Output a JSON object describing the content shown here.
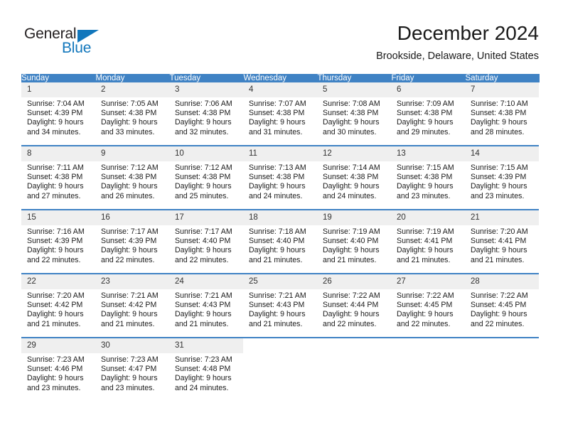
{
  "brand": {
    "name_part1": "General",
    "name_part2": "Blue",
    "accent_color": "#1277bc",
    "triangle_icon": "triangle-icon"
  },
  "header": {
    "title": "December 2024",
    "subtitle": "Brookside, Delaware, United States"
  },
  "calendar": {
    "header_bg": "#3f82c4",
    "daynum_bg": "#efefef",
    "weekdays": [
      "Sunday",
      "Monday",
      "Tuesday",
      "Wednesday",
      "Thursday",
      "Friday",
      "Saturday"
    ],
    "weeks": [
      [
        {
          "day": "1",
          "sunrise": "Sunrise: 7:04 AM",
          "sunset": "Sunset: 4:39 PM",
          "daylight_1": "Daylight: 9 hours",
          "daylight_2": "and 34 minutes."
        },
        {
          "day": "2",
          "sunrise": "Sunrise: 7:05 AM",
          "sunset": "Sunset: 4:38 PM",
          "daylight_1": "Daylight: 9 hours",
          "daylight_2": "and 33 minutes."
        },
        {
          "day": "3",
          "sunrise": "Sunrise: 7:06 AM",
          "sunset": "Sunset: 4:38 PM",
          "daylight_1": "Daylight: 9 hours",
          "daylight_2": "and 32 minutes."
        },
        {
          "day": "4",
          "sunrise": "Sunrise: 7:07 AM",
          "sunset": "Sunset: 4:38 PM",
          "daylight_1": "Daylight: 9 hours",
          "daylight_2": "and 31 minutes."
        },
        {
          "day": "5",
          "sunrise": "Sunrise: 7:08 AM",
          "sunset": "Sunset: 4:38 PM",
          "daylight_1": "Daylight: 9 hours",
          "daylight_2": "and 30 minutes."
        },
        {
          "day": "6",
          "sunrise": "Sunrise: 7:09 AM",
          "sunset": "Sunset: 4:38 PM",
          "daylight_1": "Daylight: 9 hours",
          "daylight_2": "and 29 minutes."
        },
        {
          "day": "7",
          "sunrise": "Sunrise: 7:10 AM",
          "sunset": "Sunset: 4:38 PM",
          "daylight_1": "Daylight: 9 hours",
          "daylight_2": "and 28 minutes."
        }
      ],
      [
        {
          "day": "8",
          "sunrise": "Sunrise: 7:11 AM",
          "sunset": "Sunset: 4:38 PM",
          "daylight_1": "Daylight: 9 hours",
          "daylight_2": "and 27 minutes."
        },
        {
          "day": "9",
          "sunrise": "Sunrise: 7:12 AM",
          "sunset": "Sunset: 4:38 PM",
          "daylight_1": "Daylight: 9 hours",
          "daylight_2": "and 26 minutes."
        },
        {
          "day": "10",
          "sunrise": "Sunrise: 7:12 AM",
          "sunset": "Sunset: 4:38 PM",
          "daylight_1": "Daylight: 9 hours",
          "daylight_2": "and 25 minutes."
        },
        {
          "day": "11",
          "sunrise": "Sunrise: 7:13 AM",
          "sunset": "Sunset: 4:38 PM",
          "daylight_1": "Daylight: 9 hours",
          "daylight_2": "and 24 minutes."
        },
        {
          "day": "12",
          "sunrise": "Sunrise: 7:14 AM",
          "sunset": "Sunset: 4:38 PM",
          "daylight_1": "Daylight: 9 hours",
          "daylight_2": "and 24 minutes."
        },
        {
          "day": "13",
          "sunrise": "Sunrise: 7:15 AM",
          "sunset": "Sunset: 4:38 PM",
          "daylight_1": "Daylight: 9 hours",
          "daylight_2": "and 23 minutes."
        },
        {
          "day": "14",
          "sunrise": "Sunrise: 7:15 AM",
          "sunset": "Sunset: 4:39 PM",
          "daylight_1": "Daylight: 9 hours",
          "daylight_2": "and 23 minutes."
        }
      ],
      [
        {
          "day": "15",
          "sunrise": "Sunrise: 7:16 AM",
          "sunset": "Sunset: 4:39 PM",
          "daylight_1": "Daylight: 9 hours",
          "daylight_2": "and 22 minutes."
        },
        {
          "day": "16",
          "sunrise": "Sunrise: 7:17 AM",
          "sunset": "Sunset: 4:39 PM",
          "daylight_1": "Daylight: 9 hours",
          "daylight_2": "and 22 minutes."
        },
        {
          "day": "17",
          "sunrise": "Sunrise: 7:17 AM",
          "sunset": "Sunset: 4:40 PM",
          "daylight_1": "Daylight: 9 hours",
          "daylight_2": "and 22 minutes."
        },
        {
          "day": "18",
          "sunrise": "Sunrise: 7:18 AM",
          "sunset": "Sunset: 4:40 PM",
          "daylight_1": "Daylight: 9 hours",
          "daylight_2": "and 21 minutes."
        },
        {
          "day": "19",
          "sunrise": "Sunrise: 7:19 AM",
          "sunset": "Sunset: 4:40 PM",
          "daylight_1": "Daylight: 9 hours",
          "daylight_2": "and 21 minutes."
        },
        {
          "day": "20",
          "sunrise": "Sunrise: 7:19 AM",
          "sunset": "Sunset: 4:41 PM",
          "daylight_1": "Daylight: 9 hours",
          "daylight_2": "and 21 minutes."
        },
        {
          "day": "21",
          "sunrise": "Sunrise: 7:20 AM",
          "sunset": "Sunset: 4:41 PM",
          "daylight_1": "Daylight: 9 hours",
          "daylight_2": "and 21 minutes."
        }
      ],
      [
        {
          "day": "22",
          "sunrise": "Sunrise: 7:20 AM",
          "sunset": "Sunset: 4:42 PM",
          "daylight_1": "Daylight: 9 hours",
          "daylight_2": "and 21 minutes."
        },
        {
          "day": "23",
          "sunrise": "Sunrise: 7:21 AM",
          "sunset": "Sunset: 4:42 PM",
          "daylight_1": "Daylight: 9 hours",
          "daylight_2": "and 21 minutes."
        },
        {
          "day": "24",
          "sunrise": "Sunrise: 7:21 AM",
          "sunset": "Sunset: 4:43 PM",
          "daylight_1": "Daylight: 9 hours",
          "daylight_2": "and 21 minutes."
        },
        {
          "day": "25",
          "sunrise": "Sunrise: 7:21 AM",
          "sunset": "Sunset: 4:43 PM",
          "daylight_1": "Daylight: 9 hours",
          "daylight_2": "and 21 minutes."
        },
        {
          "day": "26",
          "sunrise": "Sunrise: 7:22 AM",
          "sunset": "Sunset: 4:44 PM",
          "daylight_1": "Daylight: 9 hours",
          "daylight_2": "and 22 minutes."
        },
        {
          "day": "27",
          "sunrise": "Sunrise: 7:22 AM",
          "sunset": "Sunset: 4:45 PM",
          "daylight_1": "Daylight: 9 hours",
          "daylight_2": "and 22 minutes."
        },
        {
          "day": "28",
          "sunrise": "Sunrise: 7:22 AM",
          "sunset": "Sunset: 4:45 PM",
          "daylight_1": "Daylight: 9 hours",
          "daylight_2": "and 22 minutes."
        }
      ],
      [
        {
          "day": "29",
          "sunrise": "Sunrise: 7:23 AM",
          "sunset": "Sunset: 4:46 PM",
          "daylight_1": "Daylight: 9 hours",
          "daylight_2": "and 23 minutes."
        },
        {
          "day": "30",
          "sunrise": "Sunrise: 7:23 AM",
          "sunset": "Sunset: 4:47 PM",
          "daylight_1": "Daylight: 9 hours",
          "daylight_2": "and 23 minutes."
        },
        {
          "day": "31",
          "sunrise": "Sunrise: 7:23 AM",
          "sunset": "Sunset: 4:48 PM",
          "daylight_1": "Daylight: 9 hours",
          "daylight_2": "and 24 minutes."
        },
        {
          "day": "",
          "sunrise": "",
          "sunset": "",
          "daylight_1": "",
          "daylight_2": ""
        },
        {
          "day": "",
          "sunrise": "",
          "sunset": "",
          "daylight_1": "",
          "daylight_2": ""
        },
        {
          "day": "",
          "sunrise": "",
          "sunset": "",
          "daylight_1": "",
          "daylight_2": ""
        },
        {
          "day": "",
          "sunrise": "",
          "sunset": "",
          "daylight_1": "",
          "daylight_2": ""
        }
      ]
    ]
  }
}
